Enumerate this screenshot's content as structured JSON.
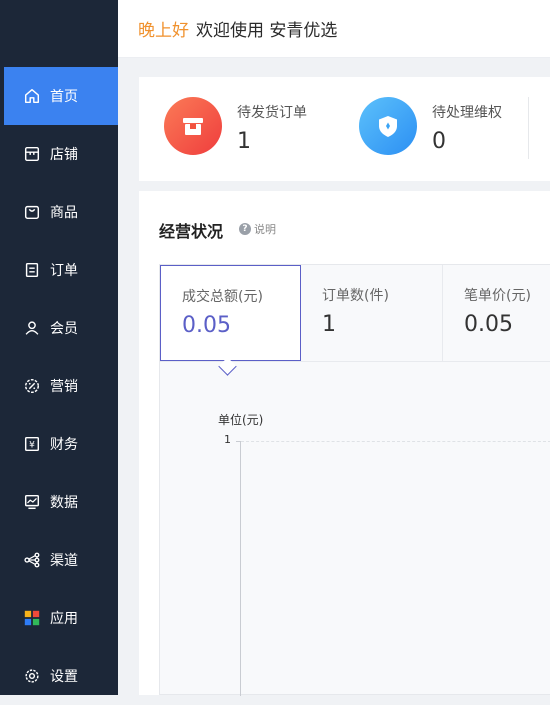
{
  "header": {
    "greeting": "晚上好",
    "welcome": "欢迎使用 安青优选"
  },
  "sidebar": {
    "items": [
      {
        "label": "首页",
        "icon": "home-icon",
        "active": true
      },
      {
        "label": "店铺",
        "icon": "store-icon"
      },
      {
        "label": "商品",
        "icon": "bag-icon"
      },
      {
        "label": "订单",
        "icon": "order-icon"
      },
      {
        "label": "会员",
        "icon": "user-icon"
      },
      {
        "label": "营销",
        "icon": "marketing-icon"
      },
      {
        "label": "财务",
        "icon": "finance-icon"
      },
      {
        "label": "数据",
        "icon": "data-icon"
      },
      {
        "label": "渠道",
        "icon": "channel-icon"
      },
      {
        "label": "应用",
        "icon": "apps-icon"
      },
      {
        "label": "设置",
        "icon": "gear-icon"
      }
    ]
  },
  "pending": {
    "items": [
      {
        "label": "待发货订单",
        "value": "1",
        "icon": "box-icon",
        "color": "#f25a45"
      },
      {
        "label": "待处理维权",
        "value": "0",
        "icon": "shield-icon",
        "color": "#3aa3f5"
      }
    ]
  },
  "business": {
    "title": "经营状况",
    "help": "说明",
    "metrics": [
      {
        "label": "成交总额(元)",
        "value": "0.05",
        "active": true
      },
      {
        "label": "订单数(件)",
        "value": "1"
      },
      {
        "label": "笔单价(元)",
        "value": "0.05"
      }
    ],
    "chart": {
      "unit": "单位(元)",
      "y_tick": "1"
    }
  },
  "colors": {
    "accent": "#3b82f0",
    "sidebar": "#1c2738",
    "greeting": "#f0912d",
    "metric_active": "#5b5fc7"
  }
}
